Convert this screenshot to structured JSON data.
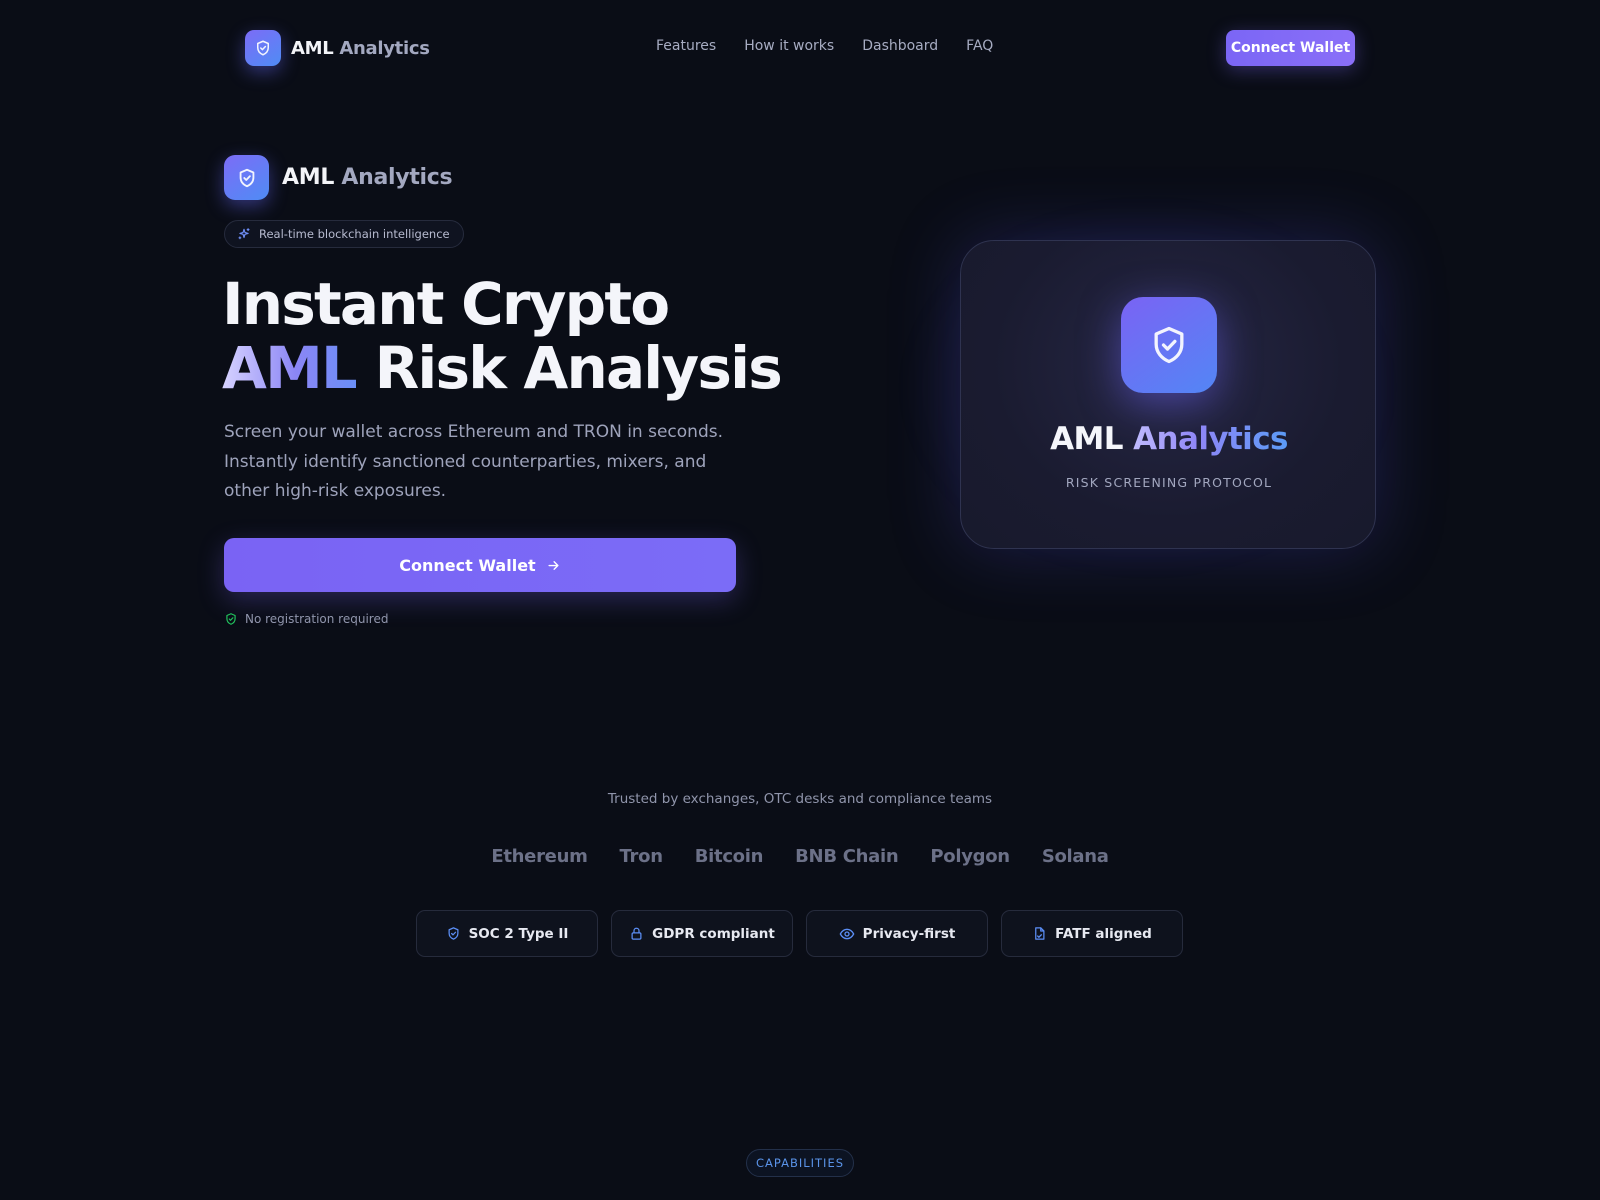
{
  "brand": {
    "name_primary": "AML",
    "name_secondary": "Analytics"
  },
  "nav": {
    "links": [
      "Features",
      "How it works",
      "Dashboard",
      "FAQ"
    ],
    "cta_label": "Connect Wallet"
  },
  "hero": {
    "chip_text": "Real-time blockchain intelligence",
    "headline_line1": "Instant Crypto",
    "headline_accent": "AML",
    "headline_line2_rest": " Risk Analysis",
    "subtitle": "Screen your wallet across Ethereum and TRON in seconds. Instantly identify sanctioned counterparties, mixers, and other high-risk exposures.",
    "cta_label": "Connect Wallet",
    "note": "No registration required"
  },
  "card": {
    "title_primary": "AML",
    "title_secondary": " Analytics",
    "subtitle": "RISK SCREENING PROTOCOL"
  },
  "trust": {
    "headline": "Trusted by exchanges, OTC desks and compliance teams",
    "chains": [
      "Ethereum",
      "Tron",
      "Bitcoin",
      "BNB Chain",
      "Polygon",
      "Solana"
    ],
    "badges": [
      {
        "label": "SOC 2 Type II",
        "icon": "shield-icon"
      },
      {
        "label": "GDPR compliant",
        "icon": "lock-icon"
      },
      {
        "label": "Privacy-first",
        "icon": "eye-icon"
      },
      {
        "label": "FATF aligned",
        "icon": "document-icon"
      }
    ]
  },
  "section_tag": "CAPABILITIES",
  "colors": {
    "background": "#0a0d16",
    "accent": "#7b66f5",
    "accent_blue": "#4f8cf5",
    "success": "#22c55e"
  }
}
